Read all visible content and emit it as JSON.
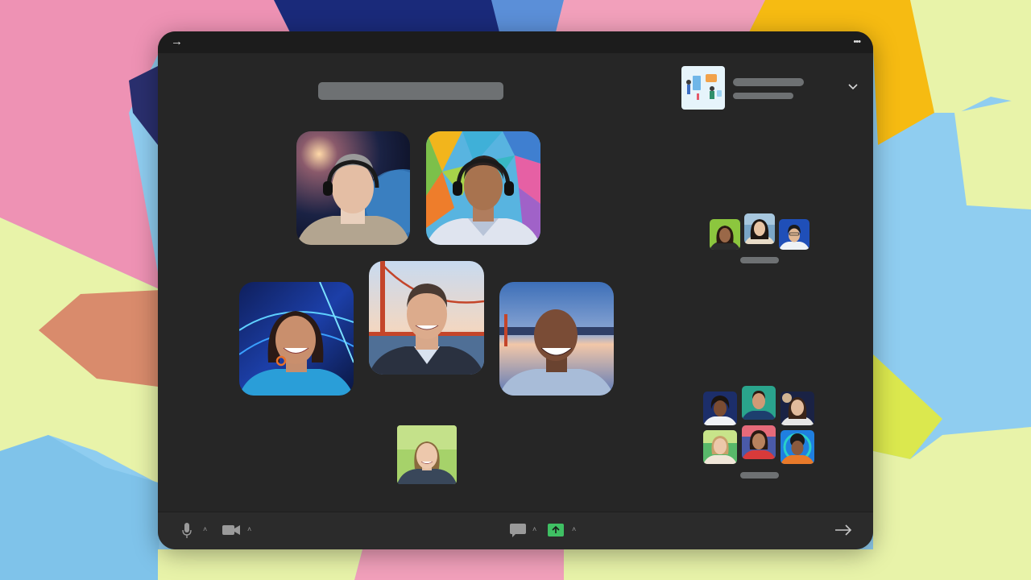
{
  "colors": {
    "window_bg": "#262626",
    "titlebar_bg": "#1c1c1c",
    "toolbar_bg": "#2b2b2b",
    "placeholder": "#6e7173",
    "share_green": "#3fbf63",
    "icon_gray": "#9a9a9a"
  },
  "icons": {
    "titlebar_left": "arrow-right-icon",
    "titlebar_right": "more-horizontal-icon",
    "expand": "chevron-down-icon",
    "mic": "microphone-icon",
    "video": "video-camera-icon",
    "chat": "chat-bubble-icon",
    "share": "share-screen-icon",
    "leave": "arrow-right-icon"
  },
  "titlebar": {
    "left_glyph": "→",
    "right_glyph": "•••"
  },
  "toolbar": {
    "caret_glyph": "˄",
    "leave_glyph": "→"
  },
  "participants": [
    {
      "name": "participant-tile-space-man"
    },
    {
      "name": "participant-tile-polygon-man"
    },
    {
      "name": "participant-tile-blue-woman"
    },
    {
      "name": "participant-tile-bridge-man"
    },
    {
      "name": "participant-tile-skyline-man"
    },
    {
      "name": "participant-tile-green-woman"
    }
  ]
}
